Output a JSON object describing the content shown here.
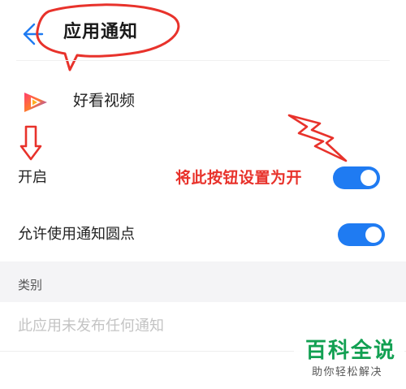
{
  "header": {
    "title": "应用通知",
    "back_icon": "back-arrow-icon"
  },
  "app": {
    "name": "好看视频",
    "icon": "haokan-video-logo-icon"
  },
  "settings": [
    {
      "label": "开启",
      "enabled": true
    },
    {
      "label": "允许使用通知圆点",
      "enabled": true
    }
  ],
  "annotation": {
    "text": "将此按钮设置为开",
    "color": "#e8322b"
  },
  "category": {
    "label": "类别",
    "empty_message": "此应用未发布任何通知"
  },
  "watermark": {
    "title": "百科全说",
    "subtitle": "助你轻松解决"
  },
  "colors": {
    "accent": "#1f7bf2",
    "annotation_red": "#e8322b",
    "watermark_green": "#12a052"
  }
}
